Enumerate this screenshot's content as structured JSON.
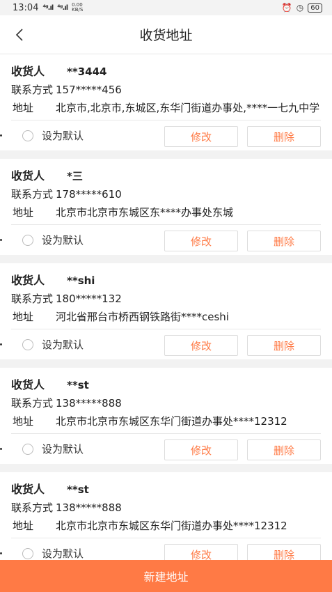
{
  "status": {
    "time": "13:04",
    "signal1": "⁴ᵍ.ıl",
    "signal2": "⁴ᵍ.ıl",
    "speed": "0.00 KB/S",
    "alarm": "⏰",
    "clock": "◷",
    "battery": "60"
  },
  "nav": {
    "title": "收货地址"
  },
  "labels": {
    "receiver": "收货人",
    "phone": "联系方式",
    "address": "地址",
    "set_default": "设为默认",
    "edit": "修改",
    "delete": "删除"
  },
  "addresses": [
    {
      "name": "**3444",
      "phone": "157*****456",
      "address": "北京市,北京市,东城区,东华门街道办事处,****一七九中学"
    },
    {
      "name": "*三",
      "phone": "178*****610",
      "address": "北京市北京市东城区东****办事处东城"
    },
    {
      "name": "**shi",
      "phone": "180*****132",
      "address": "河北省邢台市桥西钢铁路街****ceshi"
    },
    {
      "name": "**st",
      "phone": "138*****888",
      "address": "北京市北京市东城区东华门街道办事处****12312"
    },
    {
      "name": "**st",
      "phone": "138*****888",
      "address": "北京市北京市东城区东华门街道办事处****12312"
    }
  ],
  "new_address_button": "新建地址",
  "colors": {
    "accent": "#ff7a45"
  }
}
